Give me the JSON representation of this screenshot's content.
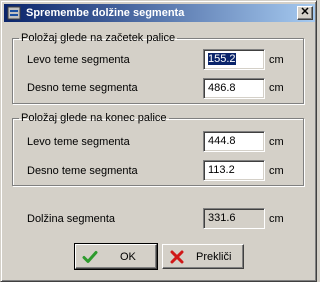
{
  "window": {
    "title": "Spremembe dolžine segmenta",
    "close_glyph": "✕",
    "title_icon": "app-icon"
  },
  "group_start": {
    "legend": "Položaj glede na začetek palice",
    "rows": [
      {
        "label": "Levo teme segmenta",
        "value": "155.2",
        "unit": "cm",
        "selected": true
      },
      {
        "label": "Desno teme segmenta",
        "value": "486.8",
        "unit": "cm",
        "selected": false
      }
    ]
  },
  "group_end": {
    "legend": "Položaj glede na konec palice",
    "rows": [
      {
        "label": "Levo teme segmenta",
        "value": "444.8",
        "unit": "cm"
      },
      {
        "label": "Desno teme segmenta",
        "value": "113.2",
        "unit": "cm"
      }
    ]
  },
  "length": {
    "label": "Dolžina segmenta",
    "value": "331.6",
    "unit": "cm"
  },
  "buttons": {
    "ok_label": "OK",
    "ok_icon": "check-icon",
    "cancel_label": "Prekliči",
    "cancel_icon": "cross-icon"
  },
  "colors": {
    "titlebar_start": "#0a246a",
    "titlebar_end": "#a6caf0",
    "face": "#d4d0c8",
    "check_green": "#2e9b2e",
    "cross_red": "#d01818"
  }
}
